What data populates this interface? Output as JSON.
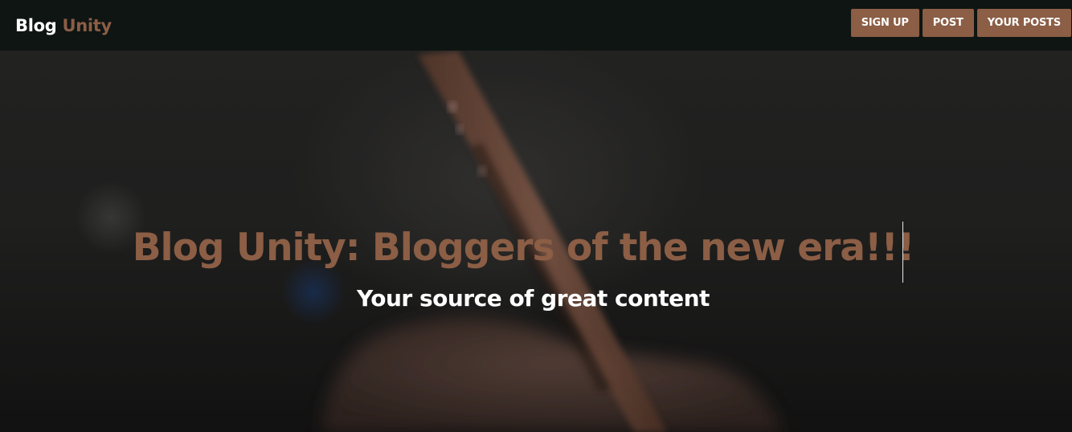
{
  "navbar": {
    "brand_part1": "Blog",
    "brand_part2": "Unity",
    "buttons": [
      "SIGN UP",
      "POST",
      "YOUR POSTS"
    ]
  },
  "hero": {
    "title": "Blog Unity: Bloggers of the new era!!!",
    "subtitle": "Your source of great content"
  },
  "colors": {
    "accent": "#8b5e45",
    "navbar_bg": "#0f1513",
    "text_light": "#ffffff"
  }
}
